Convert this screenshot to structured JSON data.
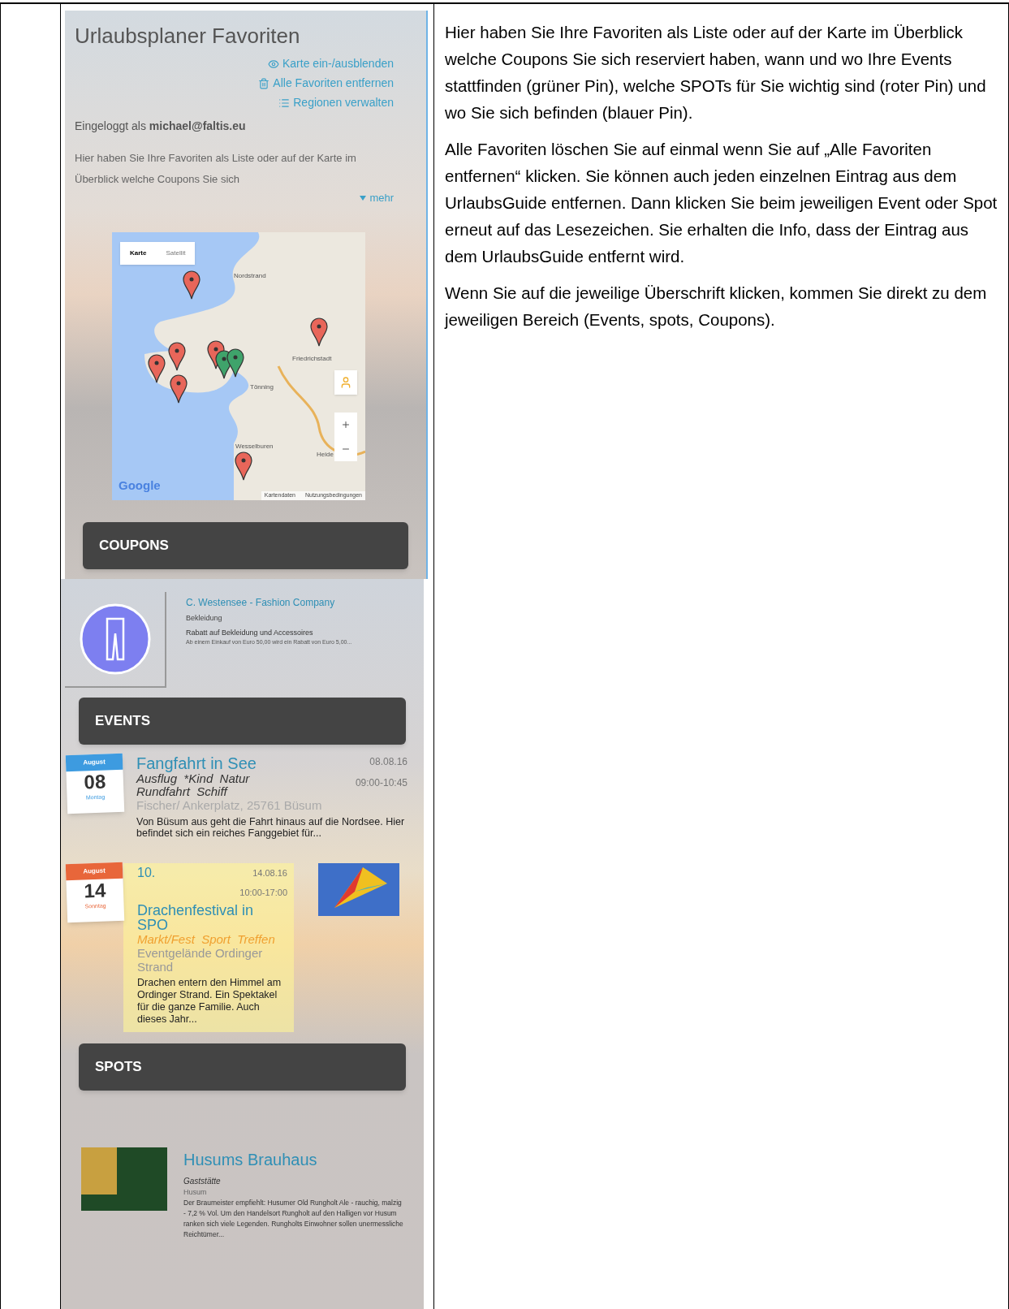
{
  "app": {
    "title": "Urlaubsplaner Favoriten",
    "links": [
      {
        "kind": "map",
        "label": "Karte ein-/ausblenden"
      },
      {
        "kind": "delete",
        "label": "Alle Favoriten entfernen"
      },
      {
        "kind": "list",
        "label": "Regionen verwalten"
      }
    ],
    "login": "Eingeloggt als **michael@faltis.eu**",
    "intro": "Hier haben Sie Ihre Favoriten als Liste oder auf der Karte im Überblick welche Coupons Sie sich",
    "more_link": "mehr",
    "map": {
      "tabs": [
        {
          "label": "Karte",
          "selected": true
        },
        {
          "label": "Satellit",
          "selected": false
        }
      ],
      "places": [
        "Nordstrand",
        "Friedrichstadt",
        "Tönning",
        "Wesselburen",
        "Heide"
      ],
      "logo": "Google",
      "attribution": [
        "Kartendaten",
        "Nutzungsbedingungen"
      ]
    },
    "coupons": {
      "header": "COUPONS",
      "items": [
        {
          "title": "C. Westensee - Fashion Company",
          "category": "Bekleidung",
          "headline": "Rabatt auf Bekleidung und Accessoires",
          "text": "Ab einem Einkauf von Euro 50,00 wird ein Rabatt von Euro 5,00..."
        }
      ]
    },
    "events": {
      "header": "EVENTS",
      "items": [
        {
          "kind": "plain",
          "color": "#3d9be0",
          "month": "August",
          "day": "08",
          "weekday": "Montag",
          "title": "Fangfahrt in See",
          "categories": "Ausflug  *Kind  Natur  Rundfahrt  Schiff",
          "location": "Fischer/ Ankerplatz, 25761 Büsum",
          "date": "08.08.16",
          "time": "09:00-10:45",
          "description": "Von Büsum aus geht die Fahrt hinaus auf die Nordsee. Hier befindet sich ein reiches Fanggebiet für..."
        },
        {
          "kind": "featured",
          "color": "#e8663a",
          "month": "August",
          "day": "14",
          "weekday": "Sonntag",
          "number": "10.",
          "title": "Drachenfestival in SPO",
          "categories": "Markt/Fest  Sport  Treffen",
          "location": "Eventgelände Ordinger Strand",
          "date": "14.08.16",
          "time": "10:00-17:00",
          "description": "Drachen entern den Himmel am Ordinger Strand. Ein Spektakel für die ganze Familie. Auch dieses Jahr..."
        }
      ]
    },
    "spots": {
      "header": "SPOTS",
      "items": [
        {
          "title": "Husums Brauhaus",
          "category": "Gaststätte",
          "place": "Husum",
          "description": "Der Braumeister empfiehlt: Husumer Old Rungholt Ale - rauchig, malzig - 7,2 % Vol. Um den Handelsort Rungholt auf den Halligen vor Husum ranken sich viele Legenden. Rungholts Einwohner sollen unermessliche Reichtümer..."
        }
      ]
    }
  },
  "explanation": [
    "Hier haben Sie Ihre Favoriten als Liste oder auf der Karte im Überblick welche Coupons Sie sich reserviert haben, wann und wo Ihre Events stattfinden (grüner Pin), welche SPOTs für Sie wichtig sind (roter Pin) und wo Sie sich befinden (blauer Pin).",
    "Alle Favoriten löschen Sie auf einmal wenn Sie auf „Alle Favoriten entfernen“ klicken. Sie können auch jeden einzelnen Eintrag aus dem UrlaubsGuide entfernen. Dann klicken Sie beim jeweiligen Event oder Spot erneut auf das Lesezeichen. Sie erhalten die Info, dass der Eintrag aus dem UrlaubsGuide entfernt wird.",
    "Wenn Sie auf die jeweilige Überschrift klicken, kommen Sie direkt zu dem jeweiligen Bereich (Events, spots, Coupons)."
  ]
}
